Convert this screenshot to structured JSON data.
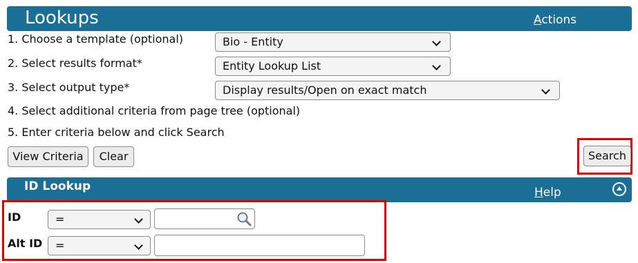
{
  "header": {
    "title": "Lookups",
    "actions_label": "Actions",
    "actions_access_key": "A",
    "actions_rest": "ctions"
  },
  "steps": [
    "1. Choose a template (optional)",
    "2. Select results format*",
    "3. Select output type*",
    "4. Select additional criteria from page tree (optional)",
    "5. Enter criteria below and click Search"
  ],
  "selects": {
    "template": "Bio - Entity",
    "results_format": "Entity Lookup List",
    "output_type": "Display results/Open on exact match"
  },
  "buttons": {
    "view_criteria": "View Criteria",
    "clear": "Clear",
    "search": "Search"
  },
  "section": {
    "title": "ID Lookup",
    "help_label": "Help",
    "help_access_key": "H",
    "help_rest": "elp"
  },
  "fields": [
    {
      "label": "ID",
      "operator": "=",
      "value": ""
    },
    {
      "label": "Alt ID",
      "operator": "=",
      "value": ""
    }
  ],
  "icons": {
    "template_dropdown": "chevron-down-icon",
    "search_lookup": "magnifier-icon",
    "collapse": "chevron-up-circle-icon"
  },
  "colors": {
    "header_bar": "#1b6f96",
    "highlight": "#e00000"
  }
}
